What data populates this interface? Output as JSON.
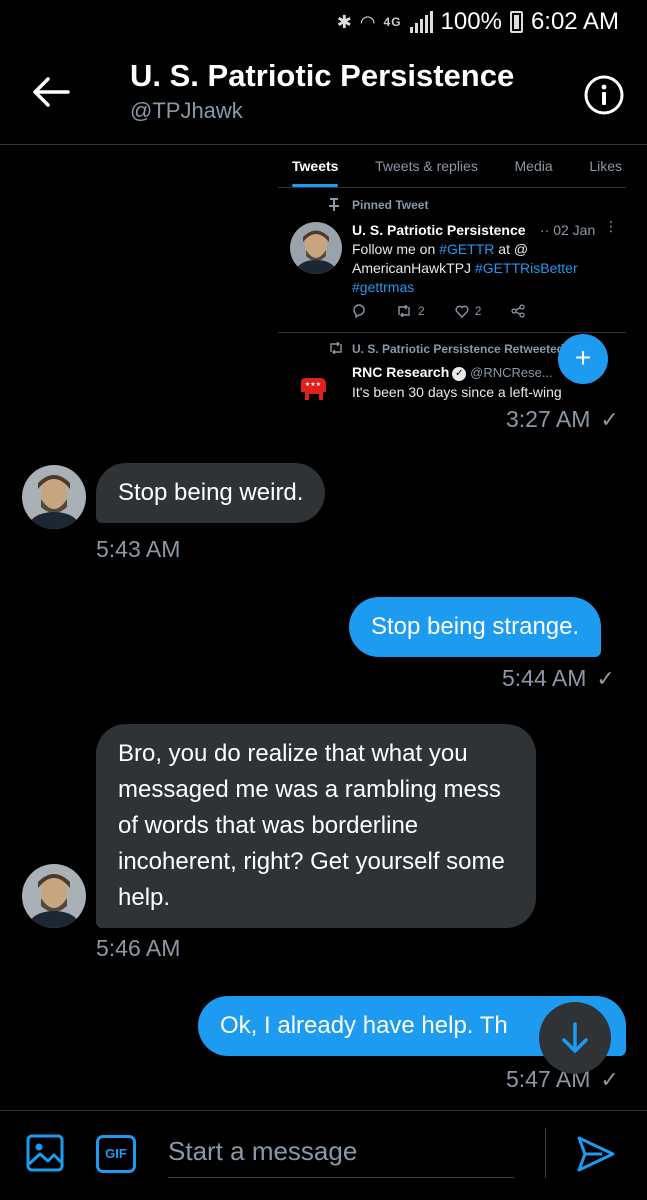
{
  "status_bar": {
    "network": "4G",
    "battery": "100%",
    "time": "6:02 AM"
  },
  "header": {
    "title": "U. S. Patriotic Persistence",
    "handle": "@TPJhawk"
  },
  "shared_screenshot": {
    "tabs": [
      "Tweets",
      "Tweets & replies",
      "Media",
      "Likes"
    ],
    "pinned_label": "Pinned Tweet",
    "pinned_tweet": {
      "name": "U. S. Patriotic Persistence",
      "date": "·· 02 Jan",
      "text_prefix": "Follow me on ",
      "hashtag_1": "#GETTR",
      "text_mid": " at @",
      "mention": "AmericanHawkTPJ ",
      "hashtag_2": "#GETTRisBetter",
      "hashtag_3": "#gettrmas",
      "retweets": "2",
      "likes": "2"
    },
    "retweet_label": "U. S. Patriotic Persistence Retweeted",
    "retweet": {
      "name": "RNC Research",
      "handle": "@RNCRese...",
      "text": "It's been 30 days since a left-wing"
    }
  },
  "messages": [
    {
      "direction": "out",
      "time": "3:27 AM"
    },
    {
      "direction": "in",
      "text": "Stop being weird.",
      "time": "5:43 AM"
    },
    {
      "direction": "out",
      "text": "Stop being strange.",
      "time": "5:44 AM"
    },
    {
      "direction": "in",
      "text": "Bro, you do realize that what you messaged me was a rambling mess of words that was borderline incoherent, right? Get yourself some help.",
      "time": "5:46 AM"
    },
    {
      "direction": "out",
      "text": "Ok, I already have help. Th",
      "time": "5:47 AM"
    }
  ],
  "composer": {
    "gif_label": "GIF",
    "placeholder": "Start a message"
  },
  "colors": {
    "accent": "#1d9bf0",
    "incoming_bubble": "#2f3336",
    "secondary_text": "#8b98a5"
  }
}
